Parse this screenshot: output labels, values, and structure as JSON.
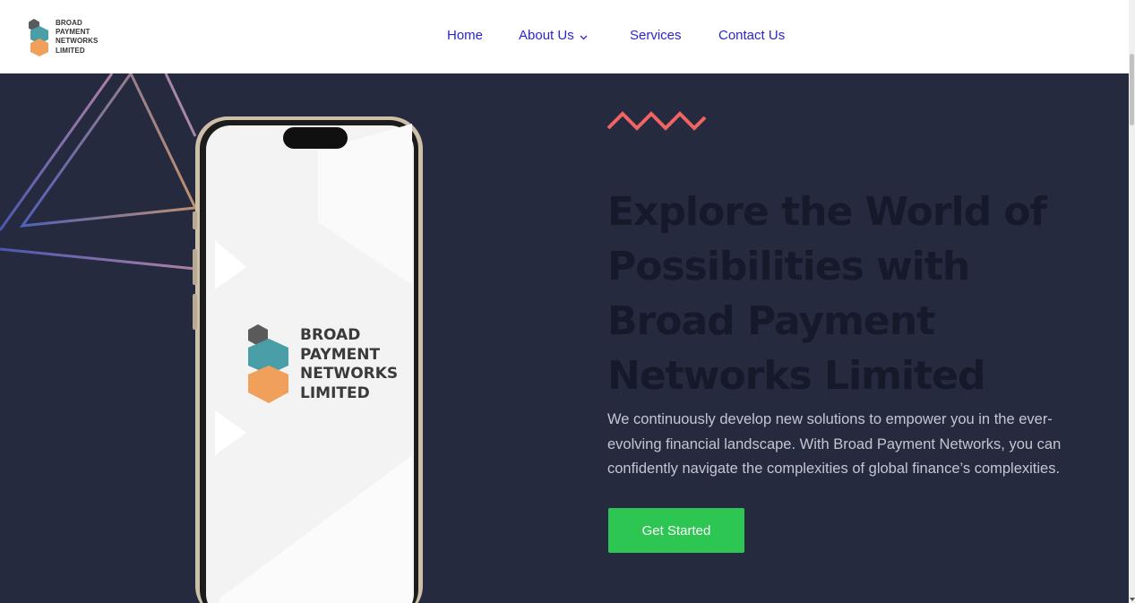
{
  "header": {
    "logo_text": [
      "BROAD",
      "PAYMENT",
      "NETWORKS",
      "LIMITED"
    ],
    "nav": {
      "home": "Home",
      "about": "About Us",
      "services": "Services",
      "contact": "Contact Us"
    }
  },
  "hero": {
    "title": "Explore the World of Possibilities with Broad Payment Networks Limited",
    "description": "We continuously develop new solutions to empower you in the ever-evolving financial landscape. With Broad Payment Networks, you can confidently navigate the complexities of global finance’s complexities.",
    "cta_label": "Get Started",
    "phone_logo_text": [
      "BROAD",
      "PAYMENT",
      "NETWORKS",
      "LIMITED"
    ]
  },
  "colors": {
    "background": "#262a3e",
    "nav_link": "#2b27c9",
    "cta": "#2dc653",
    "zigzag": "#f06464",
    "hex_gray": "#5a5a5a",
    "hex_teal": "#4a9ea8",
    "hex_orange": "#f0a05a"
  },
  "icons": {
    "about_dropdown": "chevron-down-icon"
  }
}
